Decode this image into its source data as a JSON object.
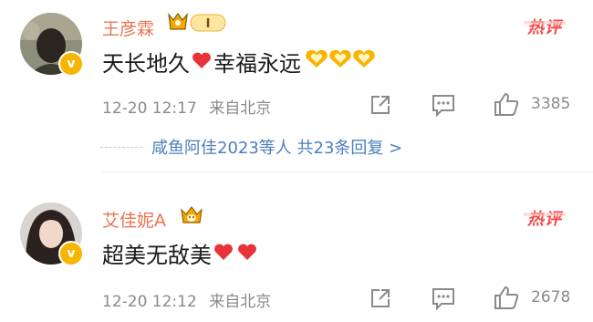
{
  "comments": [
    {
      "username": "王彦霖",
      "rank_label": "I",
      "hot_label": "热评",
      "text_before": "天长地久",
      "text_after": "幸福永远",
      "time": "12-20 12:17",
      "location": "来自北京",
      "likes": "3385"
    },
    {
      "username": "艾佳妮A",
      "hot_label": "热评",
      "text": "超美无敌美",
      "time": "12-20 12:12",
      "location": "来自北京",
      "likes": "2678"
    }
  ],
  "replies_label": "咸鱼阿佳2023等人 共23条回复 >",
  "colors": {
    "username": "#eb7350",
    "link": "#4a7fbd",
    "heart": "#e8333a",
    "gold": "#f7b500",
    "meta": "#8a8a8a"
  }
}
